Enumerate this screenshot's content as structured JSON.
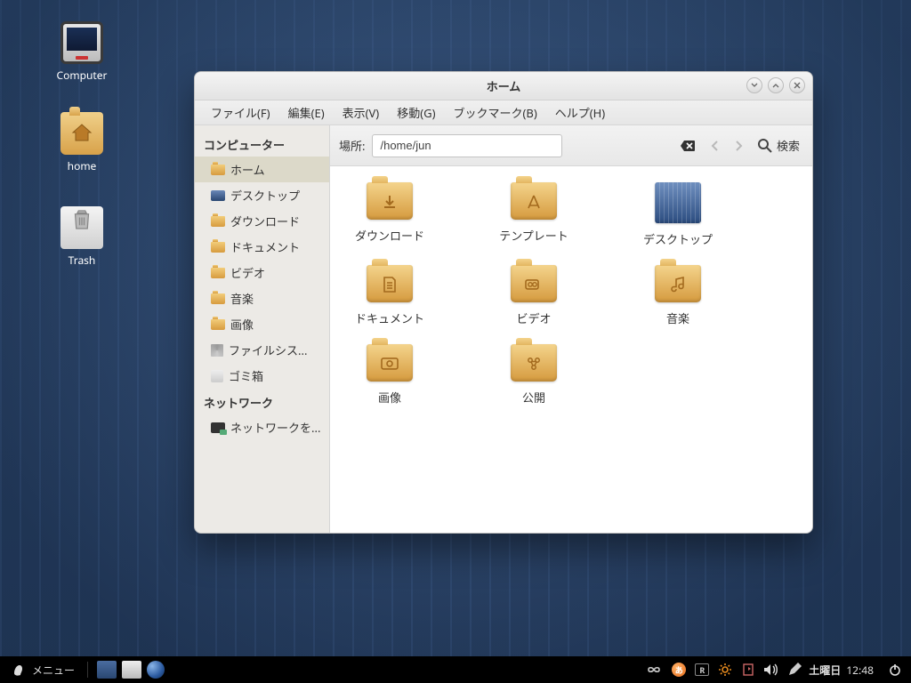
{
  "desktop_icons": {
    "computer": "Computer",
    "home": "home",
    "trash": "Trash"
  },
  "window": {
    "title": "ホーム",
    "menus": {
      "file": "ファイル(F)",
      "edit": "編集(E)",
      "view": "表示(V)",
      "go": "移動(G)",
      "bookmarks": "ブックマーク(B)",
      "help": "ヘルプ(H)"
    },
    "toolbar": {
      "location_label": "場所:",
      "location_value": "/home/jun",
      "search_label": "検索"
    },
    "sidebar": {
      "header_computer": "コンピューター",
      "items": {
        "home": "ホーム",
        "desktop": "デスクトップ",
        "downloads": "ダウンロード",
        "documents": "ドキュメント",
        "videos": "ビデオ",
        "music": "音楽",
        "pictures": "画像",
        "filesystem": "ファイルシス...",
        "trash": "ゴミ箱"
      },
      "header_network": "ネットワーク",
      "network_browse": "ネットワークを..."
    },
    "folders": {
      "downloads": "ダウンロード",
      "templates": "テンプレート",
      "desktop": "デスクトップ",
      "documents": "ドキュメント",
      "videos": "ビデオ",
      "music": "音楽",
      "pictures": "画像",
      "public": "公開"
    }
  },
  "panel": {
    "menu_label": "メニュー",
    "ime_badge": "あ",
    "keyboard_badge": "R",
    "day": "土曜日",
    "time": "12:48"
  }
}
